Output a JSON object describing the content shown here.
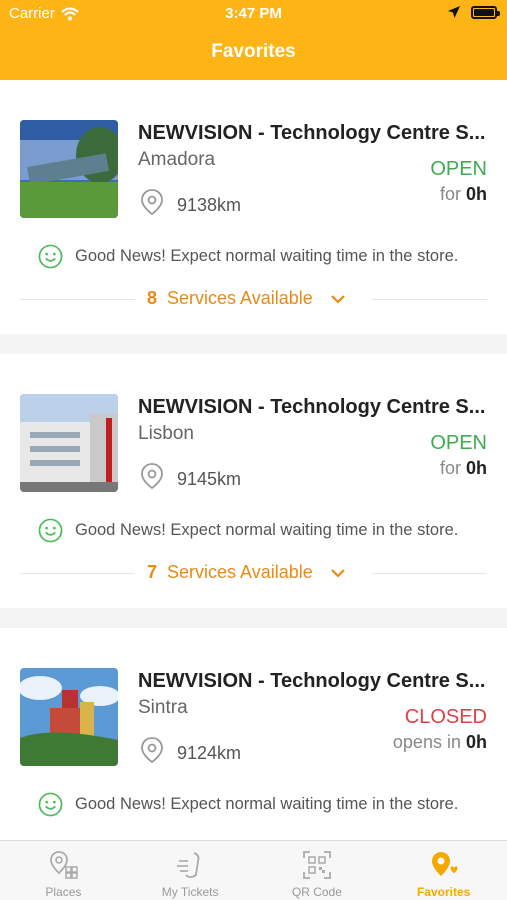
{
  "status_bar": {
    "carrier": "Carrier",
    "time": "3:47 PM"
  },
  "header": {
    "title": "Favorites"
  },
  "favorites": [
    {
      "name": "NEWVISION - Technology Centre S...",
      "city": "Amadora",
      "distance": "9138km",
      "status": "OPEN",
      "hours_prefix": "for",
      "hours_value": "0h",
      "news": "Good News! Expect normal waiting time in the store.",
      "services_count": "8",
      "services_label": "Services Available"
    },
    {
      "name": "NEWVISION - Technology Centre S...",
      "city": "Lisbon",
      "distance": "9145km",
      "status": "OPEN",
      "hours_prefix": "for",
      "hours_value": "0h",
      "news": "Good News! Expect normal waiting time in the store.",
      "services_count": "7",
      "services_label": "Services Available"
    },
    {
      "name": "NEWVISION - Technology Centre S...",
      "city": "Sintra",
      "distance": "9124km",
      "status": "CLOSED",
      "hours_prefix": "opens in",
      "hours_value": "0h",
      "news": "Good News! Expect normal waiting time in the store.",
      "services_count": "",
      "services_label": ""
    }
  ],
  "tabs": [
    {
      "label": "Places",
      "icon": "places-icon",
      "active": false
    },
    {
      "label": "My Tickets",
      "icon": "ticket-icon",
      "active": false
    },
    {
      "label": "QR Code",
      "icon": "qr-code-icon",
      "active": false
    },
    {
      "label": "Favorites",
      "icon": "favorites-icon",
      "active": true
    }
  ],
  "colors": {
    "accent": "#fdb515",
    "open": "#3dae4e",
    "closed": "#e04045",
    "services": "#e98a14"
  }
}
